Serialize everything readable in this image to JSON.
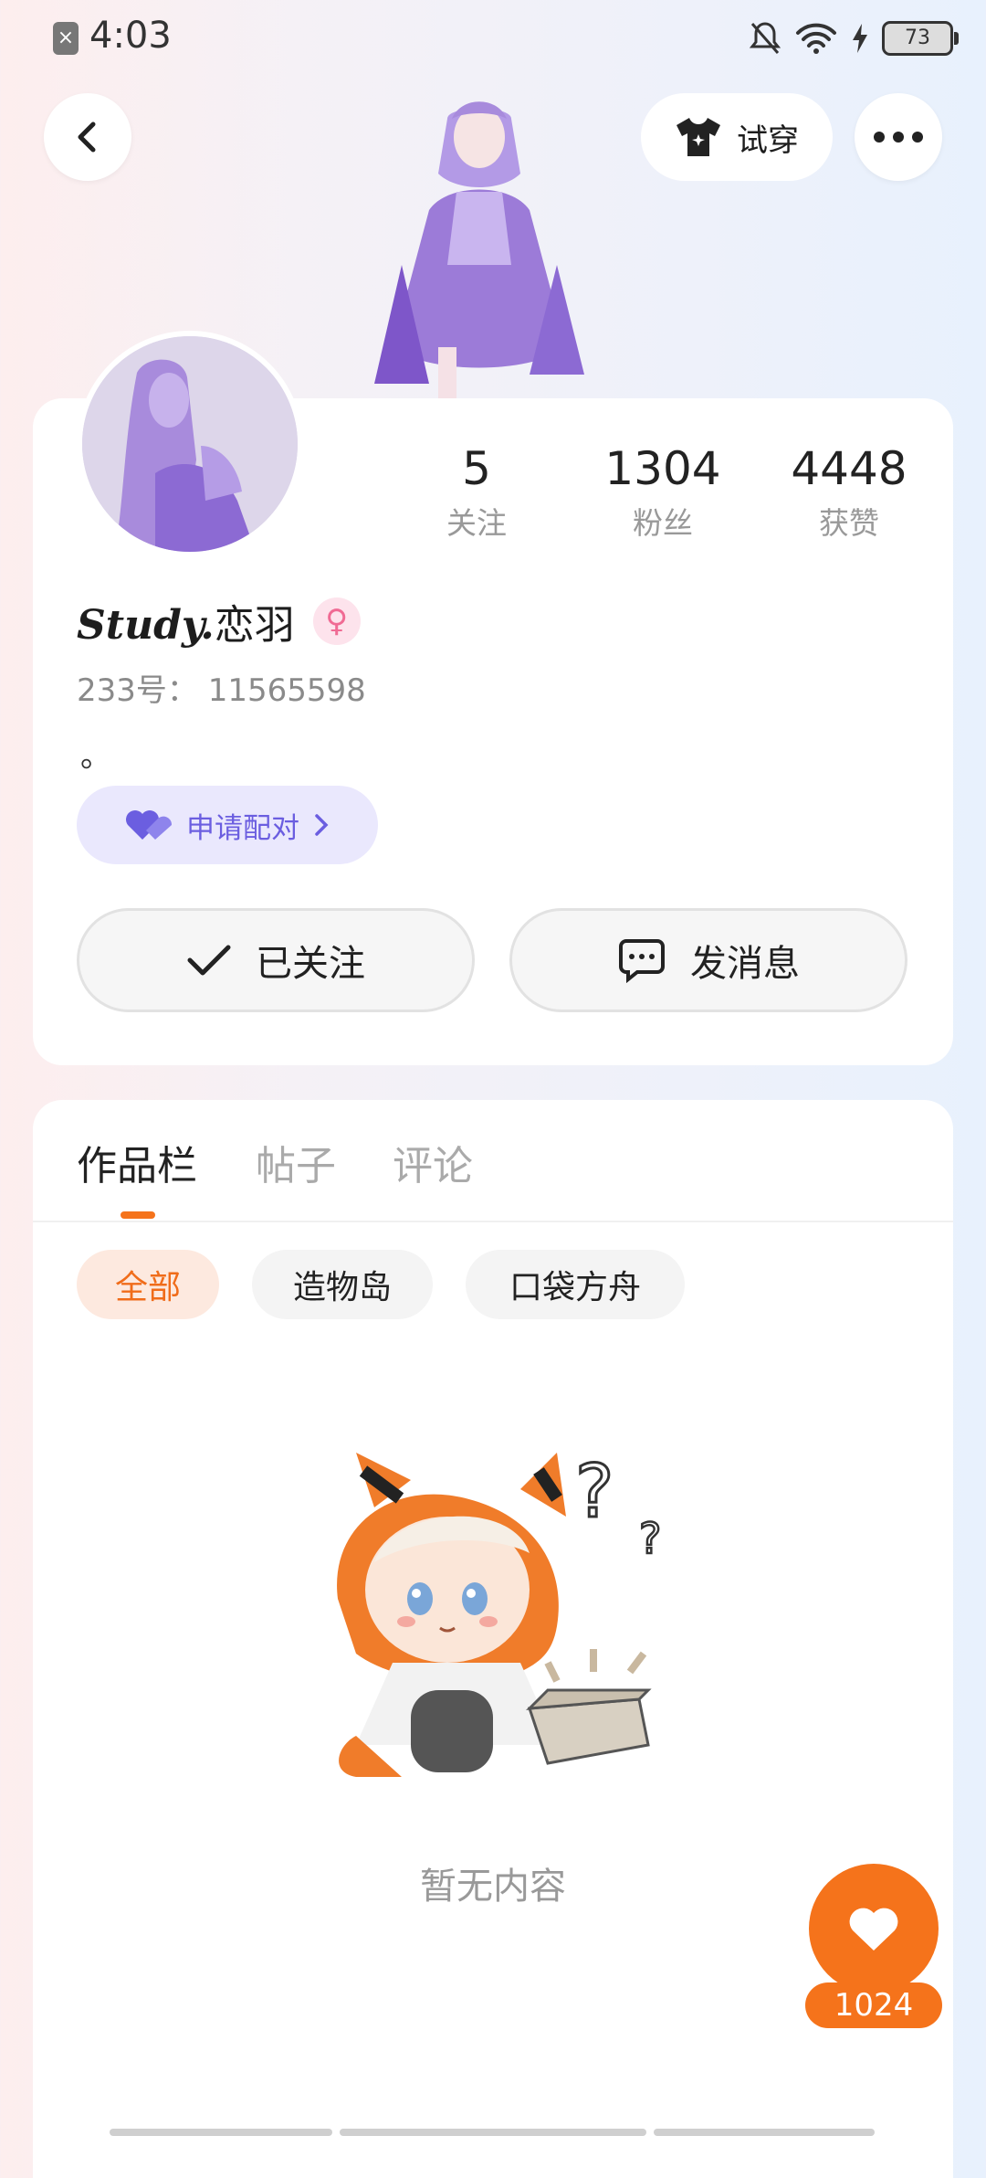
{
  "status_bar": {
    "time": "4:03",
    "battery": "73"
  },
  "header": {
    "try_on_label": "试穿"
  },
  "profile": {
    "stats": [
      {
        "value": "5",
        "label": "关注"
      },
      {
        "value": "1304",
        "label": "粉丝"
      },
      {
        "value": "4448",
        "label": "获赞"
      }
    ],
    "name_script": "Study.",
    "name_text": "恋羽",
    "uid": "233号：  11565598",
    "bio": "。",
    "pair_label": "申请配对",
    "followed_label": "已关注",
    "message_label": "发消息"
  },
  "works": {
    "tabs": [
      "作品栏",
      "帖子",
      "评论"
    ],
    "chips": [
      "全部",
      "造物岛",
      "口袋方舟"
    ],
    "empty_text": "暂无内容"
  },
  "like_count": "1024",
  "colors": {
    "accent": "#f5731b",
    "pair_purple": "#6b5ee0"
  }
}
